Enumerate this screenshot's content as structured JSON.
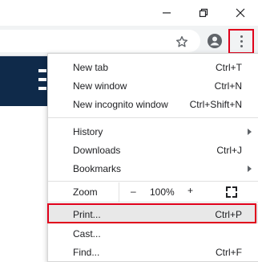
{
  "window": {
    "minimize_icon": "minimize-icon",
    "restore_icon": "restore-icon",
    "close_icon": "close-icon"
  },
  "toolbar": {
    "bookmark_icon": "star-icon",
    "profile_icon": "account-icon",
    "menu_icon": "kebab-menu-icon",
    "highlight_color": "#e0001b"
  },
  "menu": {
    "new_tab": {
      "label": "New tab",
      "shortcut": "Ctrl+T"
    },
    "new_window": {
      "label": "New window",
      "shortcut": "Ctrl+N"
    },
    "new_incognito": {
      "label": "New incognito window",
      "shortcut": "Ctrl+Shift+N"
    },
    "history": {
      "label": "History"
    },
    "downloads": {
      "label": "Downloads",
      "shortcut": "Ctrl+J"
    },
    "bookmarks": {
      "label": "Bookmarks"
    },
    "zoom": {
      "label": "Zoom",
      "minus": "–",
      "value": "100%",
      "plus": "+"
    },
    "print": {
      "label": "Print...",
      "shortcut": "Ctrl+P"
    },
    "cast": {
      "label": "Cast..."
    },
    "find": {
      "label": "Find...",
      "shortcut": "Ctrl+F"
    }
  },
  "page": {
    "header_color": "#0f2a4a"
  }
}
